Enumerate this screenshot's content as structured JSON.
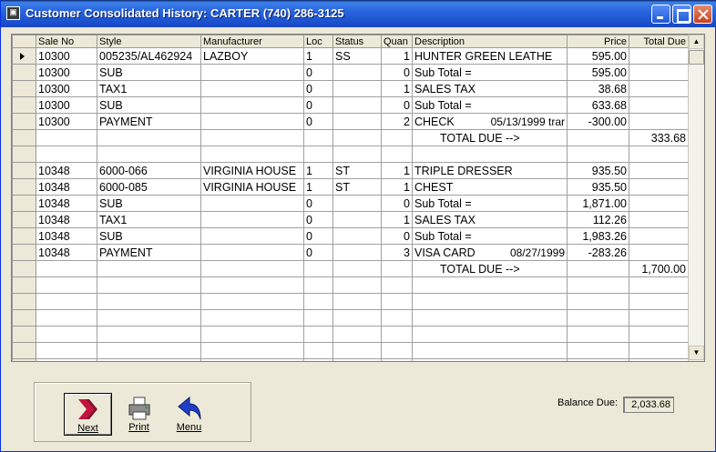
{
  "window": {
    "title": "Customer Consolidated History:  CARTER  (740) 286-3125"
  },
  "grid": {
    "columns": [
      "Sale No",
      "Style",
      "Manufacturer",
      "Loc",
      "Status",
      "Quan",
      "Description",
      "Price",
      "Total Due"
    ],
    "rows": [
      {
        "sale": "10300",
        "style": "005235/AL462924",
        "mfr": "LAZBOY",
        "loc": "1",
        "status": "SS",
        "quan": "1",
        "desc": "HUNTER GREEN LEATHE",
        "date": "",
        "price": "595.00",
        "total": ""
      },
      {
        "sale": "10300",
        "style": "SUB",
        "mfr": "",
        "loc": "0",
        "status": "",
        "quan": "0",
        "desc": "Sub Total =",
        "date": "",
        "price": "595.00",
        "total": ""
      },
      {
        "sale": "10300",
        "style": "TAX1",
        "mfr": "",
        "loc": "0",
        "status": "",
        "quan": "1",
        "desc": "SALES TAX",
        "date": "",
        "price": "38.68",
        "total": ""
      },
      {
        "sale": "10300",
        "style": "SUB",
        "mfr": "",
        "loc": "0",
        "status": "",
        "quan": "0",
        "desc": "Sub Total =",
        "date": "",
        "price": "633.68",
        "total": ""
      },
      {
        "sale": "10300",
        "style": "PAYMENT",
        "mfr": "",
        "loc": "0",
        "status": "",
        "quan": "2",
        "desc": "CHECK",
        "date": "05/13/1999 trar",
        "price": "-300.00",
        "total": ""
      },
      {
        "sale": "",
        "style": "",
        "mfr": "",
        "loc": "",
        "status": "",
        "quan": "",
        "desc": "TOTAL DUE -->",
        "date": "",
        "price": "",
        "total": "333.68"
      },
      {
        "sale": "",
        "style": "",
        "mfr": "",
        "loc": "",
        "status": "",
        "quan": "",
        "desc": "",
        "date": "",
        "price": "",
        "total": ""
      },
      {
        "sale": "10348",
        "style": "6000-066",
        "mfr": "VIRGINIA HOUSE",
        "loc": "1",
        "status": "ST",
        "quan": "1",
        "desc": "TRIPLE DRESSER",
        "date": "",
        "price": "935.50",
        "total": ""
      },
      {
        "sale": "10348",
        "style": "6000-085",
        "mfr": "VIRGINIA HOUSE",
        "loc": "1",
        "status": "ST",
        "quan": "1",
        "desc": "CHEST",
        "date": "",
        "price": "935.50",
        "total": ""
      },
      {
        "sale": "10348",
        "style": "SUB",
        "mfr": "",
        "loc": "0",
        "status": "",
        "quan": "0",
        "desc": "Sub Total =",
        "date": "",
        "price": "1,871.00",
        "total": ""
      },
      {
        "sale": "10348",
        "style": "TAX1",
        "mfr": "",
        "loc": "0",
        "status": "",
        "quan": "1",
        "desc": "SALES TAX",
        "date": "",
        "price": "112.26",
        "total": ""
      },
      {
        "sale": "10348",
        "style": "SUB",
        "mfr": "",
        "loc": "0",
        "status": "",
        "quan": "0",
        "desc": "Sub Total =",
        "date": "",
        "price": "1,983.26",
        "total": ""
      },
      {
        "sale": "10348",
        "style": "PAYMENT",
        "mfr": "",
        "loc": "0",
        "status": "",
        "quan": "3",
        "desc": "VISA CARD",
        "date": "08/27/1999",
        "price": "-283.26",
        "total": ""
      },
      {
        "sale": "",
        "style": "",
        "mfr": "",
        "loc": "",
        "status": "",
        "quan": "",
        "desc": "TOTAL DUE -->",
        "date": "",
        "price": "",
        "total": "1,700.00"
      },
      {
        "sale": "",
        "style": "",
        "mfr": "",
        "loc": "",
        "status": "",
        "quan": "",
        "desc": "",
        "date": "",
        "price": "",
        "total": ""
      },
      {
        "sale": "",
        "style": "",
        "mfr": "",
        "loc": "",
        "status": "",
        "quan": "",
        "desc": "",
        "date": "",
        "price": "",
        "total": ""
      },
      {
        "sale": "",
        "style": "",
        "mfr": "",
        "loc": "",
        "status": "",
        "quan": "",
        "desc": "",
        "date": "",
        "price": "",
        "total": ""
      },
      {
        "sale": "",
        "style": "",
        "mfr": "",
        "loc": "",
        "status": "",
        "quan": "",
        "desc": "",
        "date": "",
        "price": "",
        "total": ""
      },
      {
        "sale": "",
        "style": "",
        "mfr": "",
        "loc": "",
        "status": "",
        "quan": "",
        "desc": "",
        "date": "",
        "price": "",
        "total": ""
      },
      {
        "sale": "",
        "style": "",
        "mfr": "",
        "loc": "",
        "status": "",
        "quan": "",
        "desc": "",
        "date": "",
        "price": "",
        "total": ""
      }
    ]
  },
  "toolbar": {
    "next": {
      "label": "Next",
      "icon": "double-chevron-right-icon"
    },
    "print": {
      "label": "Print",
      "icon": "printer-icon"
    },
    "menu": {
      "label": "Menu",
      "icon": "back-arrow-icon"
    }
  },
  "balance": {
    "label": "Balance Due:",
    "value": "2,033.68"
  },
  "colors": {
    "title_bar": "#1e56d2",
    "window_bg": "#ece9d8",
    "next_icon": "#c0143c",
    "menu_icon": "#1f3fc8"
  }
}
